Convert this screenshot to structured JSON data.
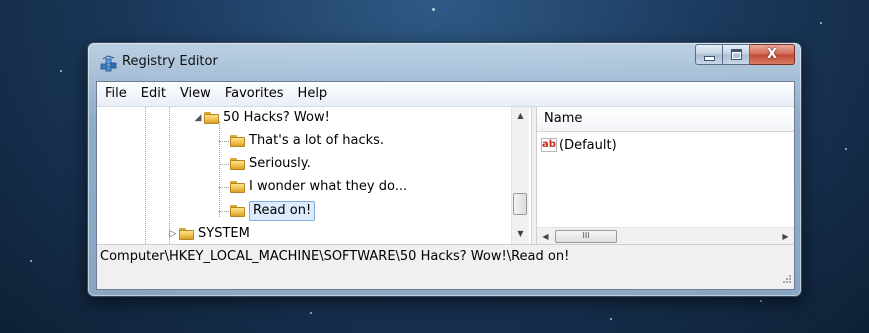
{
  "window": {
    "title": "Registry Editor",
    "caption_buttons": {
      "minimize_glyph": "–",
      "maximize_glyph": "☐",
      "close_glyph": "X"
    }
  },
  "menu": [
    "File",
    "Edit",
    "View",
    "Favorites",
    "Help"
  ],
  "tree": {
    "parent": {
      "label": "50 Hacks? Wow!",
      "expanded_glyph": "◢"
    },
    "children": [
      "That's a lot of hacks.",
      "Seriously.",
      "I wonder what they do...",
      "Read on!"
    ],
    "selected": "Read on!",
    "sibling": {
      "label": "SYSTEM",
      "collapsed_glyph": "▷"
    }
  },
  "list": {
    "column_header": "Name",
    "rows": [
      {
        "icon": "string-value-icon",
        "icon_glyph": "ab",
        "name": "(Default)"
      }
    ]
  },
  "scrollbars": {
    "vertical": {
      "up": "▲",
      "down": "▼"
    },
    "horizontal": {
      "left": "◀",
      "right": "▶",
      "thumb_grip": "III"
    }
  },
  "status_bar": {
    "path": "Computer\\HKEY_LOCAL_MACHINE\\SOFTWARE\\50 Hacks? Wow!\\Read on!"
  },
  "colors": {
    "selection_fill": "#dcecfc",
    "selection_border": "#84acdd",
    "close_button": "#c14a34"
  }
}
